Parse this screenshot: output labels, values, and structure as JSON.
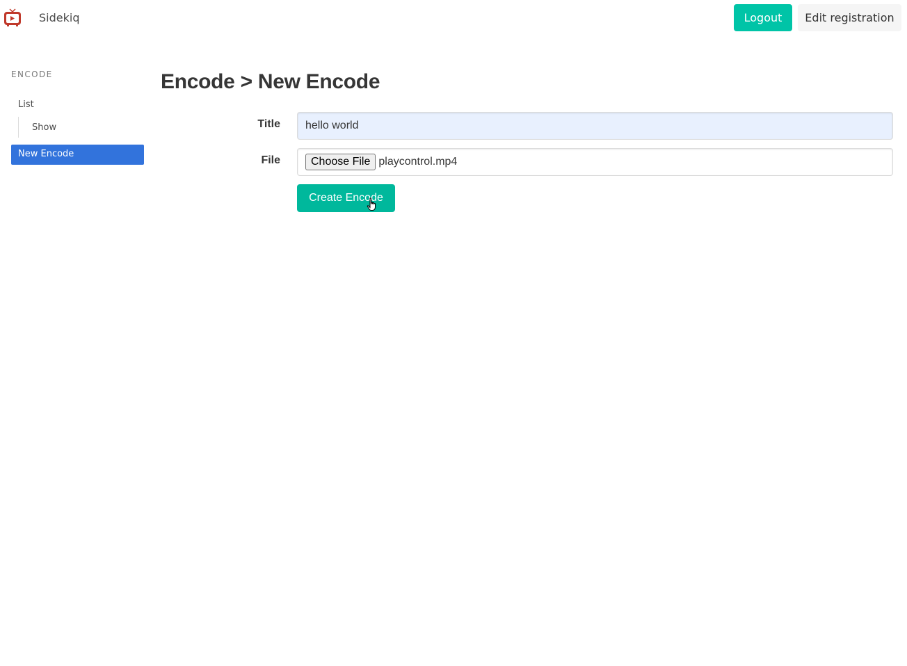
{
  "navbar": {
    "brand_icon": "tv-play-icon",
    "brand_name": "Sidekiq",
    "logout_label": "Logout",
    "edit_registration_label": "Edit registration"
  },
  "sidebar": {
    "section_label": "ENCODE",
    "items": [
      {
        "label": "List"
      },
      {
        "label": "Show"
      },
      {
        "label": "New Encode",
        "active": true
      }
    ]
  },
  "main": {
    "title": "Encode > New Encode",
    "form": {
      "title_label": "Title",
      "title_value": "hello world",
      "file_label": "File",
      "choose_file_label": "Choose File",
      "file_name": "playcontrol.mp4",
      "submit_label": "Create Encode"
    }
  },
  "colors": {
    "primary": "#00c4a7",
    "active_menu": "#3273dc",
    "autofill": "#e8f0fe"
  }
}
